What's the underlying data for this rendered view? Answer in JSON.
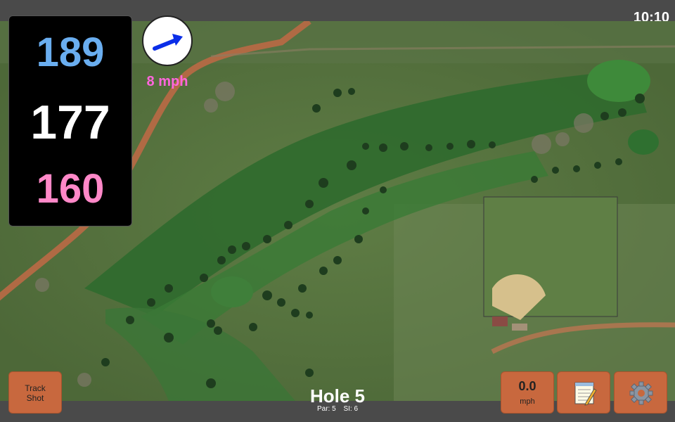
{
  "status": {
    "time": "10:10"
  },
  "distances": {
    "back": {
      "value": "189",
      "color": "#6aaef0"
    },
    "middle": {
      "value": "177",
      "color": "#ffffff"
    },
    "front": {
      "value": "160",
      "color": "#ff88c8"
    }
  },
  "wind": {
    "speed": "8 mph",
    "arrow_color": "#0a2ee8",
    "speed_color": "#ff66dd"
  },
  "hole": {
    "title": "Hole 5",
    "par": "Par: 5",
    "si": "SI: 6"
  },
  "buttons": {
    "track_shot": {
      "line1": "Track",
      "line2": "Shot"
    },
    "speed": {
      "value": "0.0",
      "unit": "mph"
    },
    "notes_icon": "notepad-icon",
    "settings_icon": "gear-icon"
  },
  "colors": {
    "button": "#c8683e",
    "bar": "#4a4a4a"
  }
}
